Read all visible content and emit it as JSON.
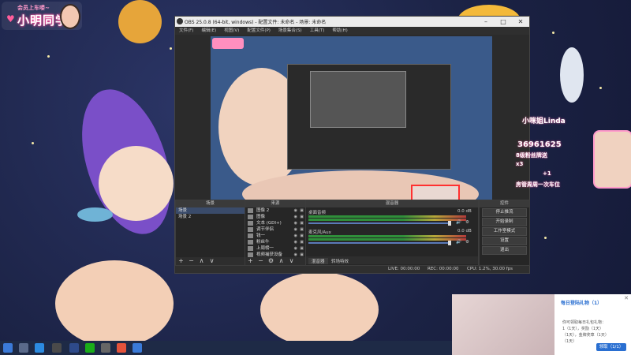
{
  "brand": {
    "subtitle": "会员上车喽~",
    "name": "小明同学"
  },
  "obs": {
    "title": "OBS 25.0.8 (64-bit, windows) - 配置文件: 未命名 - 场景: 未命名",
    "menu": [
      "文件(F)",
      "编辑(E)",
      "视图(V)",
      "配置文件(P)",
      "场景集合(S)",
      "工具(T)",
      "帮助(H)"
    ],
    "scenes_header": "场景",
    "scenes": [
      "场景",
      "场景 2"
    ],
    "sources_header": "来源",
    "sources": [
      "图像 2",
      "图像",
      "文本 (GDI+)",
      "调节伴侣",
      "钱一",
      "粉丝牛",
      "上周榜一",
      "视频捕获设备"
    ],
    "mixer_header": "混音器",
    "mixer": [
      {
        "label": "桌面音频",
        "db": "0.0 dB"
      },
      {
        "label": "麦克风/Aux",
        "db": "0.0 dB"
      }
    ],
    "bottom_tabs": [
      "混音器",
      "转场特效"
    ],
    "controls_header": "控件",
    "controls": [
      "停止推流",
      "开始录制",
      "工作室模式",
      "设置",
      "退出"
    ],
    "status": {
      "live": "LIVE: 00:00:00",
      "rec": "REC: 00:00:00",
      "cpu": "CPU: 1.2%, 30.00 fps"
    }
  },
  "overlay": {
    "streamer": "小咪姐Linda",
    "count": "36961625",
    "line1": "8级粉丝牌送",
    "line2": "x3",
    "line3": "+1",
    "line4": "房管周周一次车位"
  },
  "gift_popup": {
    "title": "每日登陆礼物（1）",
    "lines": [
      "你可领取每日礼包礼物：",
      "1（1天），奖励（1天）",
      "（1天），金牌奖章（1天）",
      "（1天）"
    ],
    "button": "领取（1/1）"
  },
  "colors": {
    "accent": "#2a6fd1",
    "pink": "#ff4f9e",
    "obs_bg": "#2b2b2b"
  }
}
